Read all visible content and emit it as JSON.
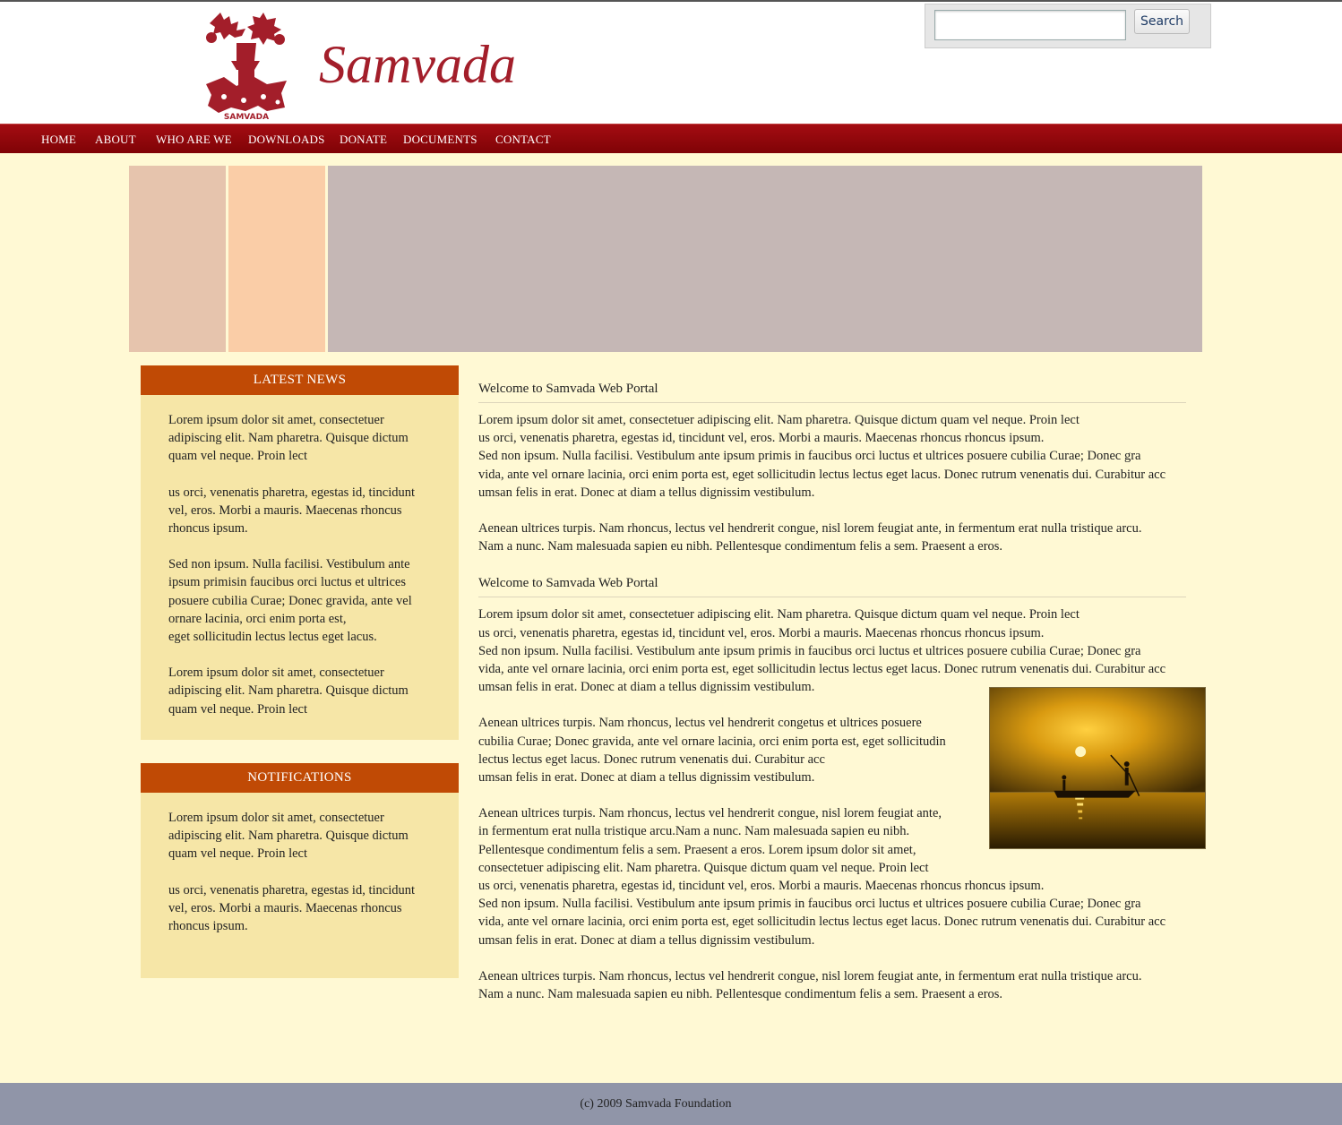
{
  "header": {
    "brand": "Samvada",
    "logo_text": "SAMVADA",
    "search": {
      "placeholder": "",
      "button": "Search"
    }
  },
  "nav": {
    "items": [
      "HOME",
      "ABOUT",
      "WHO ARE WE",
      "DOWNLOADS",
      "DONATE",
      "DOCUMENTS",
      "CONTACT"
    ]
  },
  "sidebar": {
    "news": {
      "title": "LATEST NEWS",
      "paragraphs": [
        "Lorem ipsum dolor sit amet, consectetuer\nadipiscing elit. Nam pharetra. Quisque dictum\nquam vel neque. Proin lect",
        "us orci, venenatis pharetra, egestas id, tincidunt\nvel, eros. Morbi a mauris. Maecenas rhoncus\nrhoncus ipsum.",
        "Sed non ipsum. Nulla facilisi. Vestibulum ante\n ipsum primisin faucibus orci luctus et ultrices\n posuere cubilia Curae; Donec gravida, ante vel\nornare lacinia, orci enim porta est,\neget sollicitudin lectus lectus eget lacus.",
        "Lorem ipsum dolor sit amet, consectetuer\nadipiscing elit. Nam pharetra. Quisque dictum\nquam vel neque. Proin lect"
      ]
    },
    "notifications": {
      "title": "NOTIFICATIONS",
      "paragraphs": [
        "Lorem ipsum dolor sit amet, consectetuer\nadipiscing elit. Nam pharetra. Quisque dictum\nquam vel neque. Proin lect",
        "us orci, venenatis pharetra, egestas id, tincidunt\nvel, eros. Morbi a mauris. Maecenas rhoncus\nrhoncus ipsum."
      ]
    }
  },
  "main": {
    "section1": {
      "title": "Welcome to Samvada Web Portal",
      "p1": "Lorem ipsum dolor sit amet, consectetuer adipiscing elit. Nam pharetra. Quisque dictum quam vel neque. Proin lect\nus orci, venenatis pharetra, egestas id, tincidunt vel, eros. Morbi a mauris. Maecenas rhoncus rhoncus ipsum.\nSed non ipsum. Nulla facilisi. Vestibulum ante ipsum primis in faucibus orci luctus et ultrices posuere cubilia Curae; Donec gra\nvida, ante vel ornare lacinia, orci enim porta est, eget sollicitudin lectus lectus eget lacus. Donec rutrum venenatis dui. Curabitur acc\numsan felis in erat. Donec at diam a tellus dignissim vestibulum.",
      "p2": "Aenean ultrices turpis. Nam rhoncus, lectus vel hendrerit congue, nisl lorem feugiat ante, in fermentum erat nulla tristique arcu.\nNam a nunc. Nam malesuada sapien eu nibh. Pellentesque condimentum felis a sem. Praesent a eros."
    },
    "section2": {
      "title": "Welcome to Samvada Web Portal",
      "p1": "Lorem ipsum dolor sit amet, consectetuer adipiscing elit. Nam pharetra. Quisque dictum quam vel neque. Proin lect\nus orci, venenatis pharetra, egestas id, tincidunt vel, eros. Morbi a mauris. Maecenas rhoncus rhoncus ipsum.\nSed non ipsum. Nulla facilisi. Vestibulum ante ipsum primis in faucibus orci luctus et ultrices posuere cubilia Curae; Donec gra\nvida, ante vel ornare lacinia, orci enim porta est, eget sollicitudin lectus lectus eget lacus. Donec rutrum venenatis dui. Curabitur acc\numsan felis in erat. Donec at diam a tellus dignissim vestibulum.",
      "p2": "Aenean ultrices turpis. Nam rhoncus, lectus vel hendrerit congetus et ultrices posuere\ncubilia Curae; Donec gravida, ante vel ornare lacinia, orci enim porta est, eget sollicitudin\n lectus lectus eget lacus. Donec rutrum venenatis dui. Curabitur acc\numsan felis in erat. Donec at diam a tellus dignissim vestibulum.",
      "p3": "Aenean ultrices turpis. Nam rhoncus, lectus vel hendrerit congue, nisl lorem feugiat ante,\nin fermentum erat nulla tristique arcu.Nam a nunc. Nam malesuada sapien eu nibh.\n Pellentesque condimentum felis a sem. Praesent a eros. Lorem ipsum dolor sit amet,\nconsectetuer adipiscing elit. Nam pharetra. Quisque dictum quam vel neque. Proin lect\nus orci, venenatis pharetra, egestas id, tincidunt vel, eros. Morbi a mauris. Maecenas rhoncus rhoncus ipsum.\nSed non ipsum. Nulla facilisi. Vestibulum ante ipsum primis in faucibus orci luctus et ultrices posuere cubilia Curae; Donec gra\nvida, ante vel ornare lacinia, orci enim porta est, eget sollicitudin lectus lectus eget lacus. Donec rutrum venenatis dui. Curabitur acc\numsan felis in erat. Donec at diam a tellus dignissim vestibulum.",
      "p4": "Aenean ultrices turpis. Nam rhoncus, lectus vel hendrerit congue, nisl lorem feugiat ante, in fermentum erat nulla tristique arcu.\nNam a nunc. Nam malesuada sapien eu nibh. Pellentesque condimentum felis a sem. Praesent a eros."
    }
  },
  "footer": {
    "text": "(c) 2009 Samvada Foundation"
  },
  "colors": {
    "accent_red": "#8f0609",
    "panel_header": "#c04a05",
    "panel_bg": "#f6e6a7",
    "page_bg": "#fff9d4",
    "footer_bg": "#9095a8",
    "brand": "#a31e2a"
  },
  "icons": {
    "logo": "tree-logo-icon",
    "photo": "sunset-boat-photo"
  }
}
